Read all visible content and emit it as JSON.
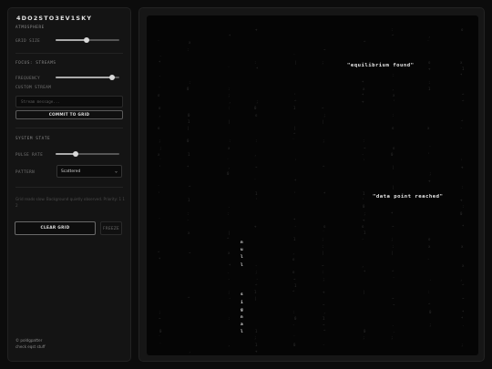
{
  "app": {
    "title": "4DO2STO3EV1SKY"
  },
  "atmosphere": {
    "section_label": "ATMOSPHERE",
    "grid_size_label": "GRID SIZE",
    "grid_size_level": 0.48
  },
  "focus_streams": {
    "section_label": "FOCUS: STREAMS",
    "frequency_label": "FREQUENCY",
    "frequency_level": 0.88,
    "custom_stream_label": "CUSTOM STREAM",
    "custom_stream_placeholder": "Stream message...",
    "commit_label": "COMMIT TO GRID"
  },
  "system_state": {
    "section_label": "SYSTEM STATE",
    "pulse_rate_label": "PULSE RATE",
    "pulse_rate_level": 0.32,
    "pattern_label": "PATTERN",
    "pattern_value": "Scattered"
  },
  "status": {
    "text": "Grid reads slow. Background quietly observed. Priority: 1 1 2"
  },
  "controls": {
    "clear_label": "CLEAR GRID",
    "freeze_label": "FREEZE"
  },
  "credits": {
    "line1": "© poldgpatter",
    "line2": "check eqst stuff"
  },
  "grid": {
    "phrases": [
      {
        "text": "\"equilibrium found\""
      },
      {
        "text": "\"data point reached\""
      }
    ],
    "vertical_stream": [
      "n",
      "u",
      "l",
      "l",
      "",
      "",
      "",
      "s",
      "i",
      "g",
      "n",
      "a",
      "l"
    ],
    "glyph_chars": "0 1 : . | ; ' ` , - ~ ^ * + x o"
  },
  "colors": {
    "background": "#0c0c0c",
    "panel": "#141414",
    "grid_dim": "#2f2f2f",
    "grid_bright": "#e6e6e6",
    "accent_text": "#e8e8e8"
  }
}
